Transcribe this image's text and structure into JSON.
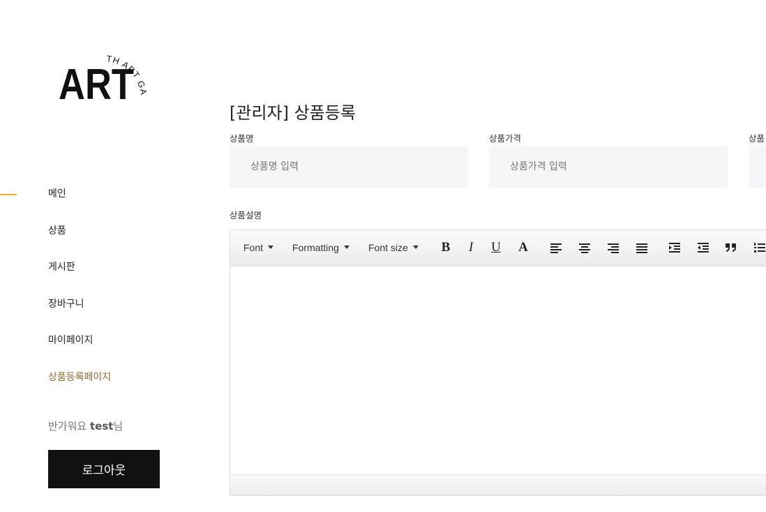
{
  "brand": {
    "logo_text": "ART",
    "logo_arc_text": "TH ART GALLERY"
  },
  "sidebar": {
    "nav": [
      {
        "label": "메인",
        "active": true
      },
      {
        "label": "상품"
      },
      {
        "label": "게시판"
      },
      {
        "label": "장바구니"
      },
      {
        "label": "마이페이지"
      },
      {
        "label": "상품등록페이지"
      }
    ],
    "greeting_prefix": "반가워요 ",
    "user_name": "test",
    "greeting_suffix": "님",
    "logout_label": "로그아웃"
  },
  "main": {
    "title": "[관리자] 상품등록",
    "fields": [
      {
        "label": "상품명",
        "placeholder": "상품명 입력",
        "value": ""
      },
      {
        "label": "상품가격",
        "placeholder": "상품가격 입력",
        "value": ""
      },
      {
        "label": "상품",
        "placeholder": "",
        "value": ""
      }
    ],
    "description_label": "상품설명"
  },
  "editor": {
    "dropdowns": [
      "Font",
      "Formatting",
      "Font size"
    ],
    "style_buttons": {
      "bold": "B",
      "italic": "I",
      "underline": "U",
      "color": "A"
    },
    "icons": [
      "bold-icon",
      "italic-icon",
      "underline-icon",
      "text-color-icon",
      "align-left-icon",
      "align-center-icon",
      "align-right-icon",
      "align-justify-icon",
      "indent-icon",
      "outdent-icon",
      "blockquote-icon",
      "ordered-list-icon"
    ],
    "content": ""
  },
  "colors": {
    "accent": "#f2b01e",
    "active_link": "#8a6d2b",
    "button_bg": "#111111",
    "input_bg": "#f5f6f8"
  }
}
